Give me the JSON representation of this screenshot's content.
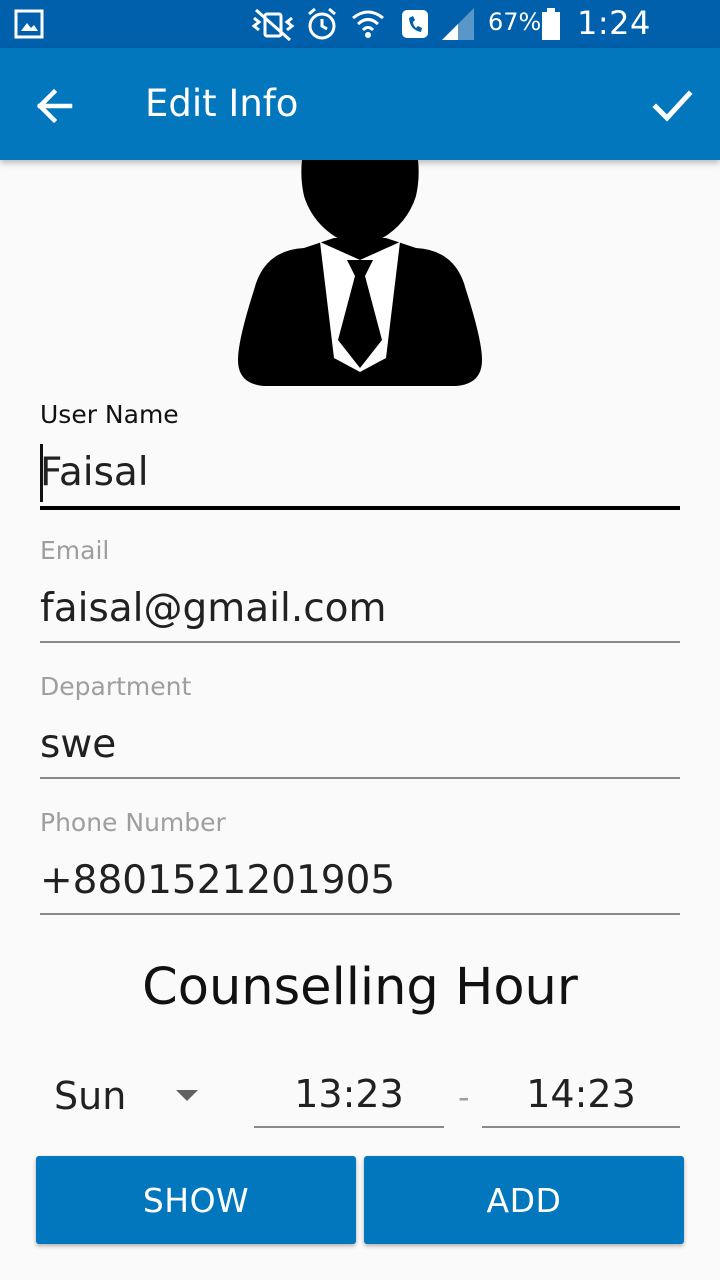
{
  "status_bar": {
    "battery": "67%",
    "time": "1:24 p.m.",
    "icons": [
      "gallery-icon",
      "vibrate-off-icon",
      "alarm-icon",
      "wifi-icon",
      "call-icon",
      "signal-icon",
      "battery-icon"
    ]
  },
  "app_bar": {
    "title": "Edit Info",
    "color": "#0277bd"
  },
  "form": {
    "user_name": {
      "label": "User Name",
      "value": "Faisal"
    },
    "email": {
      "label": "Email",
      "value": "faisal@gmail.com"
    },
    "department": {
      "label": "Department",
      "value": "swe"
    },
    "phone": {
      "label": "Phone Number",
      "value": "+8801521201905"
    }
  },
  "counselling": {
    "title": "Counselling Hour",
    "day": "Sun",
    "start_time": "13:23",
    "separator": "-",
    "end_time": "14:23"
  },
  "buttons": {
    "show": "SHOW",
    "add": "ADD"
  }
}
